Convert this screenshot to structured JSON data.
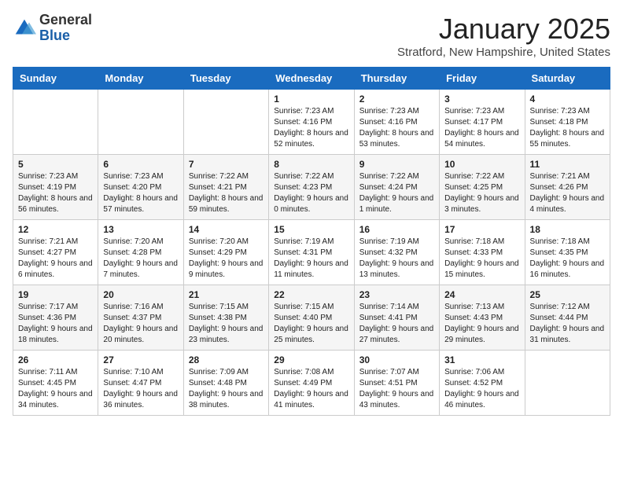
{
  "header": {
    "logo_general": "General",
    "logo_blue": "Blue",
    "month_title": "January 2025",
    "location": "Stratford, New Hampshire, United States"
  },
  "weekdays": [
    "Sunday",
    "Monday",
    "Tuesday",
    "Wednesday",
    "Thursday",
    "Friday",
    "Saturday"
  ],
  "weeks": [
    [
      {
        "day": "",
        "info": ""
      },
      {
        "day": "",
        "info": ""
      },
      {
        "day": "",
        "info": ""
      },
      {
        "day": "1",
        "info": "Sunrise: 7:23 AM\nSunset: 4:16 PM\nDaylight: 8 hours and 52 minutes."
      },
      {
        "day": "2",
        "info": "Sunrise: 7:23 AM\nSunset: 4:16 PM\nDaylight: 8 hours and 53 minutes."
      },
      {
        "day": "3",
        "info": "Sunrise: 7:23 AM\nSunset: 4:17 PM\nDaylight: 8 hours and 54 minutes."
      },
      {
        "day": "4",
        "info": "Sunrise: 7:23 AM\nSunset: 4:18 PM\nDaylight: 8 hours and 55 minutes."
      }
    ],
    [
      {
        "day": "5",
        "info": "Sunrise: 7:23 AM\nSunset: 4:19 PM\nDaylight: 8 hours and 56 minutes."
      },
      {
        "day": "6",
        "info": "Sunrise: 7:23 AM\nSunset: 4:20 PM\nDaylight: 8 hours and 57 minutes."
      },
      {
        "day": "7",
        "info": "Sunrise: 7:22 AM\nSunset: 4:21 PM\nDaylight: 8 hours and 59 minutes."
      },
      {
        "day": "8",
        "info": "Sunrise: 7:22 AM\nSunset: 4:23 PM\nDaylight: 9 hours and 0 minutes."
      },
      {
        "day": "9",
        "info": "Sunrise: 7:22 AM\nSunset: 4:24 PM\nDaylight: 9 hours and 1 minute."
      },
      {
        "day": "10",
        "info": "Sunrise: 7:22 AM\nSunset: 4:25 PM\nDaylight: 9 hours and 3 minutes."
      },
      {
        "day": "11",
        "info": "Sunrise: 7:21 AM\nSunset: 4:26 PM\nDaylight: 9 hours and 4 minutes."
      }
    ],
    [
      {
        "day": "12",
        "info": "Sunrise: 7:21 AM\nSunset: 4:27 PM\nDaylight: 9 hours and 6 minutes."
      },
      {
        "day": "13",
        "info": "Sunrise: 7:20 AM\nSunset: 4:28 PM\nDaylight: 9 hours and 7 minutes."
      },
      {
        "day": "14",
        "info": "Sunrise: 7:20 AM\nSunset: 4:29 PM\nDaylight: 9 hours and 9 minutes."
      },
      {
        "day": "15",
        "info": "Sunrise: 7:19 AM\nSunset: 4:31 PM\nDaylight: 9 hours and 11 minutes."
      },
      {
        "day": "16",
        "info": "Sunrise: 7:19 AM\nSunset: 4:32 PM\nDaylight: 9 hours and 13 minutes."
      },
      {
        "day": "17",
        "info": "Sunrise: 7:18 AM\nSunset: 4:33 PM\nDaylight: 9 hours and 15 minutes."
      },
      {
        "day": "18",
        "info": "Sunrise: 7:18 AM\nSunset: 4:35 PM\nDaylight: 9 hours and 16 minutes."
      }
    ],
    [
      {
        "day": "19",
        "info": "Sunrise: 7:17 AM\nSunset: 4:36 PM\nDaylight: 9 hours and 18 minutes."
      },
      {
        "day": "20",
        "info": "Sunrise: 7:16 AM\nSunset: 4:37 PM\nDaylight: 9 hours and 20 minutes."
      },
      {
        "day": "21",
        "info": "Sunrise: 7:15 AM\nSunset: 4:38 PM\nDaylight: 9 hours and 23 minutes."
      },
      {
        "day": "22",
        "info": "Sunrise: 7:15 AM\nSunset: 4:40 PM\nDaylight: 9 hours and 25 minutes."
      },
      {
        "day": "23",
        "info": "Sunrise: 7:14 AM\nSunset: 4:41 PM\nDaylight: 9 hours and 27 minutes."
      },
      {
        "day": "24",
        "info": "Sunrise: 7:13 AM\nSunset: 4:43 PM\nDaylight: 9 hours and 29 minutes."
      },
      {
        "day": "25",
        "info": "Sunrise: 7:12 AM\nSunset: 4:44 PM\nDaylight: 9 hours and 31 minutes."
      }
    ],
    [
      {
        "day": "26",
        "info": "Sunrise: 7:11 AM\nSunset: 4:45 PM\nDaylight: 9 hours and 34 minutes."
      },
      {
        "day": "27",
        "info": "Sunrise: 7:10 AM\nSunset: 4:47 PM\nDaylight: 9 hours and 36 minutes."
      },
      {
        "day": "28",
        "info": "Sunrise: 7:09 AM\nSunset: 4:48 PM\nDaylight: 9 hours and 38 minutes."
      },
      {
        "day": "29",
        "info": "Sunrise: 7:08 AM\nSunset: 4:49 PM\nDaylight: 9 hours and 41 minutes."
      },
      {
        "day": "30",
        "info": "Sunrise: 7:07 AM\nSunset: 4:51 PM\nDaylight: 9 hours and 43 minutes."
      },
      {
        "day": "31",
        "info": "Sunrise: 7:06 AM\nSunset: 4:52 PM\nDaylight: 9 hours and 46 minutes."
      },
      {
        "day": "",
        "info": ""
      }
    ]
  ]
}
